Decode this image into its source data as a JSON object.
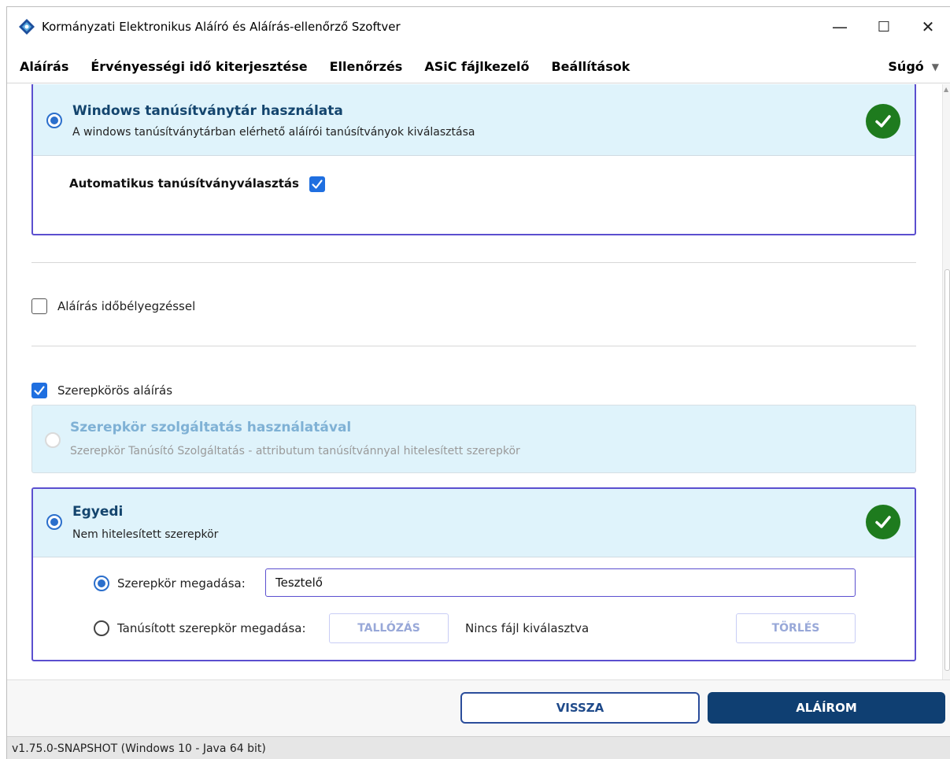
{
  "window": {
    "title": "Kormányzati Elektronikus Aláíró és Aláírás-ellenőrző Szoftver",
    "minimize": "—",
    "maximize": "☐",
    "close": "✕"
  },
  "menu": {
    "items": [
      "Aláírás",
      "Érvényességi idő kiterjesztése",
      "Ellenőrzés",
      "ASiC fájlkezelő",
      "Beállítások"
    ],
    "help": "Súgó",
    "help_caret": "▼"
  },
  "windows_store": {
    "title": "Windows tanúsítványtár használata",
    "subtitle": "A windows tanúsítványtárban elérhető aláírói tanúsítványok kiválasztása",
    "auto_select_label": "Automatikus tanúsítványválasztás",
    "selected": true,
    "auto_select_checked": true
  },
  "timestamp": {
    "label": "Aláírás időbélyegzéssel",
    "checked": false
  },
  "role_signature": {
    "label": "Szerepkörös aláírás",
    "checked": true,
    "service": {
      "title": "Szerepkör szolgáltatás használatával",
      "subtitle": "Szerepkör Tanúsító Szolgáltatás - attributum tanúsítvánnyal hitelesített szerepkör",
      "disabled": true
    },
    "custom": {
      "title": "Egyedi",
      "subtitle": "Nem hitelesített szerepkör",
      "role_label": "Szerepkör megadása:",
      "role_value": "Tesztelő",
      "certified_label": "Tanúsított szerepkör megadása:",
      "browse": "TALLÓZÁS",
      "no_file": "Nincs fájl kiválasztva",
      "delete": "TÖRLÉS"
    }
  },
  "footer": {
    "back": "VISSZA",
    "sign": "ALÁÍROM"
  },
  "status": "v1.75.0-SNAPSHOT (Windows 10 - Java 64 bit)",
  "colors": {
    "accent": "#5b4fcf",
    "panel": "#dff3fb",
    "success": "#1e7b1e",
    "primary": "#0f3f72"
  }
}
